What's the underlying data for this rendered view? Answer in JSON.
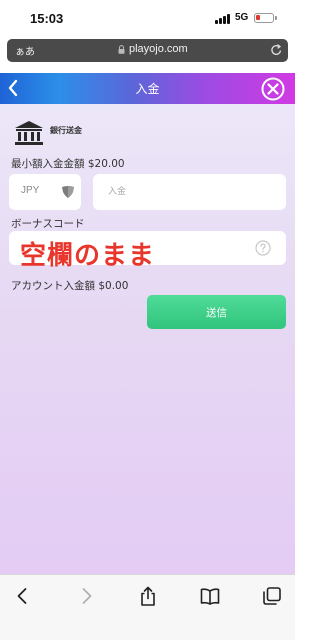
{
  "status_bar": {
    "time": "15:03",
    "network": "5G"
  },
  "browser": {
    "text_size_label": "ぁあ",
    "url": "playojo.com"
  },
  "header": {
    "title": "入金"
  },
  "deposit": {
    "method_label": "銀行送金",
    "min_deposit_label": "最小額入金金額 $20.00",
    "currency_value": "JPY",
    "amount_placeholder": "入金",
    "bonus_code_label": "ボーナスコード",
    "bonus_code_value": "",
    "annotation_text": "空欄のまま",
    "account_deposit_label": "アカウント入金額 $0.00",
    "submit_label": "送信"
  },
  "colors": {
    "header_gradient_start": "#1f63d6",
    "header_gradient_end": "#d23ae3",
    "submit_button": "#3bcc86",
    "annotation": "#e8362c"
  },
  "toolbar": {
    "icons": [
      "back-icon",
      "forward-icon",
      "share-icon",
      "bookmarks-icon",
      "tabs-icon"
    ]
  }
}
